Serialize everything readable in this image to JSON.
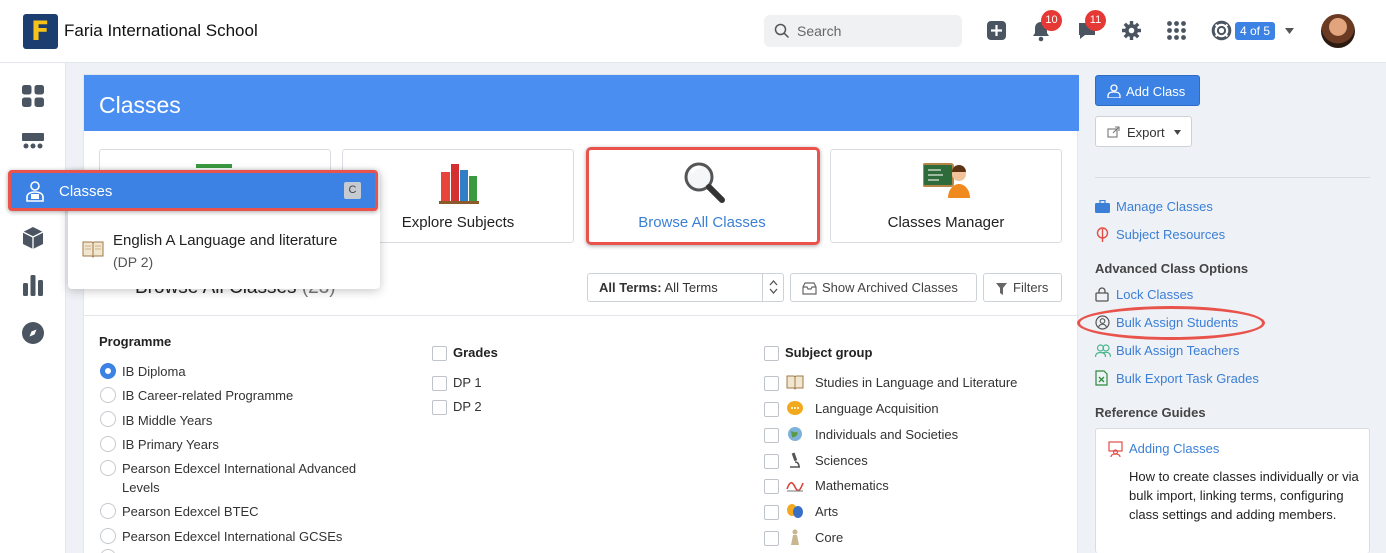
{
  "app": {
    "school_name": "Faria International School",
    "logo_letter": "F"
  },
  "topbar": {
    "search_placeholder": "Search",
    "notifications_count": "10",
    "messages_count": "11",
    "term_indicator": "4 of 5"
  },
  "page": {
    "title": "Classes"
  },
  "tiles": [
    {
      "label": "Explore Subjects"
    },
    {
      "label": "Browse All Classes"
    },
    {
      "label": "Classes Manager"
    }
  ],
  "browse": {
    "title": "Browse All Classes",
    "count": "(23)",
    "term_select": {
      "label": "All Terms:",
      "value": "All Terms"
    },
    "show_archived": "Show Archived Classes",
    "filters": "Filters"
  },
  "programme": {
    "heading": "Programme",
    "options": [
      "IB Diploma",
      "IB Career-related Programme",
      "IB Middle Years",
      "IB Primary Years",
      "Pearson Edexcel International Advanced Levels",
      "Pearson Edexcel BTEC",
      "Pearson Edexcel International GCSEs"
    ],
    "selected": "IB Diploma"
  },
  "grades": {
    "heading": "Grades",
    "options": [
      "DP 1",
      "DP 2"
    ]
  },
  "subject_group": {
    "heading": "Subject group",
    "options": [
      "Studies in Language and Literature",
      "Language Acquisition",
      "Individuals and Societies",
      "Sciences",
      "Mathematics",
      "Arts",
      "Core"
    ]
  },
  "popup": {
    "highlighted": {
      "label": "Classes",
      "shortcut": "C"
    },
    "item": {
      "line1": "English A Language and literature",
      "line2": "(DP 2)"
    }
  },
  "right": {
    "add_class": "Add Class",
    "export": "Export",
    "links": [
      "Manage Classes",
      "Subject Resources"
    ],
    "advanced_heading": "Advanced Class Options",
    "advanced_links": [
      "Lock Classes",
      "Bulk Assign Students",
      "Bulk Assign Teachers",
      "Bulk Export Task Grades"
    ],
    "reference_heading": "Reference Guides",
    "guide": {
      "title": "Adding Classes",
      "text": "How to create classes individually or via bulk import, linking terms, configuring class settings and adding members."
    }
  },
  "colors": {
    "accent": "#3b82e4",
    "header": "#4b8ef1",
    "highlight": "#e8534b",
    "badge": "#e53935",
    "brand_navy": "#1c3d70",
    "brand_yellow": "#f5c31a"
  }
}
